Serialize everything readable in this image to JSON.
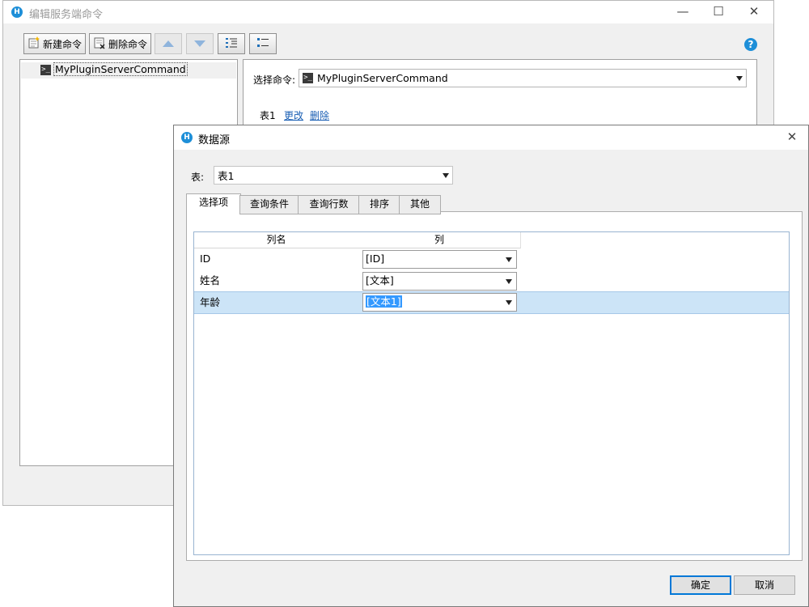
{
  "back_window": {
    "title": "编辑服务端命令",
    "app_icon_letter": "H",
    "toolbar": {
      "new_command": "新建命令",
      "delete_command": "删除命令"
    },
    "tree": {
      "items": [
        {
          "label": "MyPluginServerCommand",
          "icon": "terminal-icon"
        }
      ]
    },
    "select_command_label": "选择命令:",
    "select_command_value": "MyPluginServerCommand",
    "table_label": "表1",
    "change_link": "更改",
    "delete_link": "删除"
  },
  "dialog": {
    "title": "数据源",
    "app_icon_letter": "H",
    "table_label": "表:",
    "table_value": "表1",
    "tabs": [
      "选择项",
      "查询条件",
      "查询行数",
      "排序",
      "其他"
    ],
    "selected_tab": 0,
    "grid": {
      "headers": [
        "列名",
        "列"
      ],
      "rows": [
        {
          "name": "ID",
          "column": "[ID]",
          "selected": false
        },
        {
          "name": "姓名",
          "column": "[文本]",
          "selected": false
        },
        {
          "name": "年龄",
          "column": "[文本1]",
          "selected": true
        }
      ]
    },
    "ok_button": "确定",
    "cancel_button": "取消"
  },
  "colors": {
    "accent": "#1e8fd8",
    "selection_row": "#cce4f7",
    "text_selection": "#3399ff",
    "link": "#1a5fb4"
  }
}
